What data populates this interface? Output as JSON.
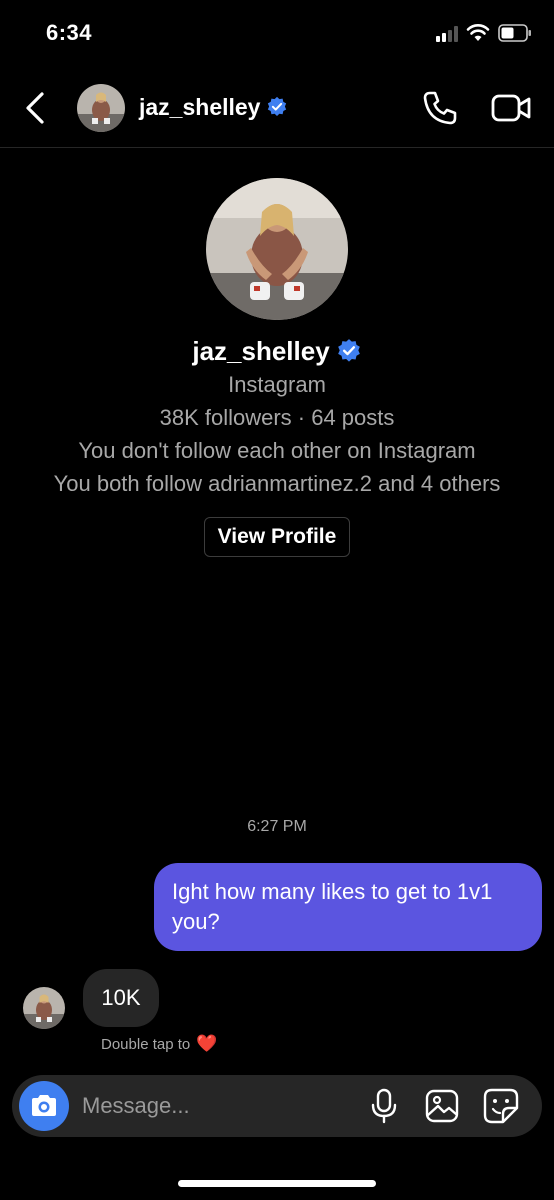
{
  "status_bar": {
    "time": "6:34"
  },
  "header": {
    "username": "jaz_shelley",
    "icons": [
      "back-arrow-icon",
      "verified-badge-icon",
      "phone-icon",
      "video-camera-icon"
    ]
  },
  "profile": {
    "username": "jaz_shelley",
    "platform": "Instagram",
    "stats": "38K followers · 64 posts",
    "follow_status": "You don't follow each other on Instagram",
    "mutuals": "You both follow adrianmartinez.2 and 4 others",
    "view_profile_label": "View Profile"
  },
  "conversation": {
    "timestamp": "6:27 PM",
    "messages": [
      {
        "direction": "outgoing",
        "text": "Ight how many likes to get to 1v1 you?"
      },
      {
        "direction": "incoming",
        "text": "10K"
      }
    ],
    "double_tap_hint": "Double tap to",
    "double_tap_emoji": "❤️"
  },
  "composer": {
    "placeholder": "Message...",
    "icons": [
      "camera-icon",
      "microphone-icon",
      "gallery-icon",
      "sticker-icon"
    ]
  },
  "colors": {
    "background": "#000000",
    "outgoing_bubble": "#5b55e0",
    "incoming_bubble": "#262626",
    "verified_blue": "#3f7ff0",
    "secondary_text": "#a8a8a8",
    "heart_red": "#ed4956"
  }
}
